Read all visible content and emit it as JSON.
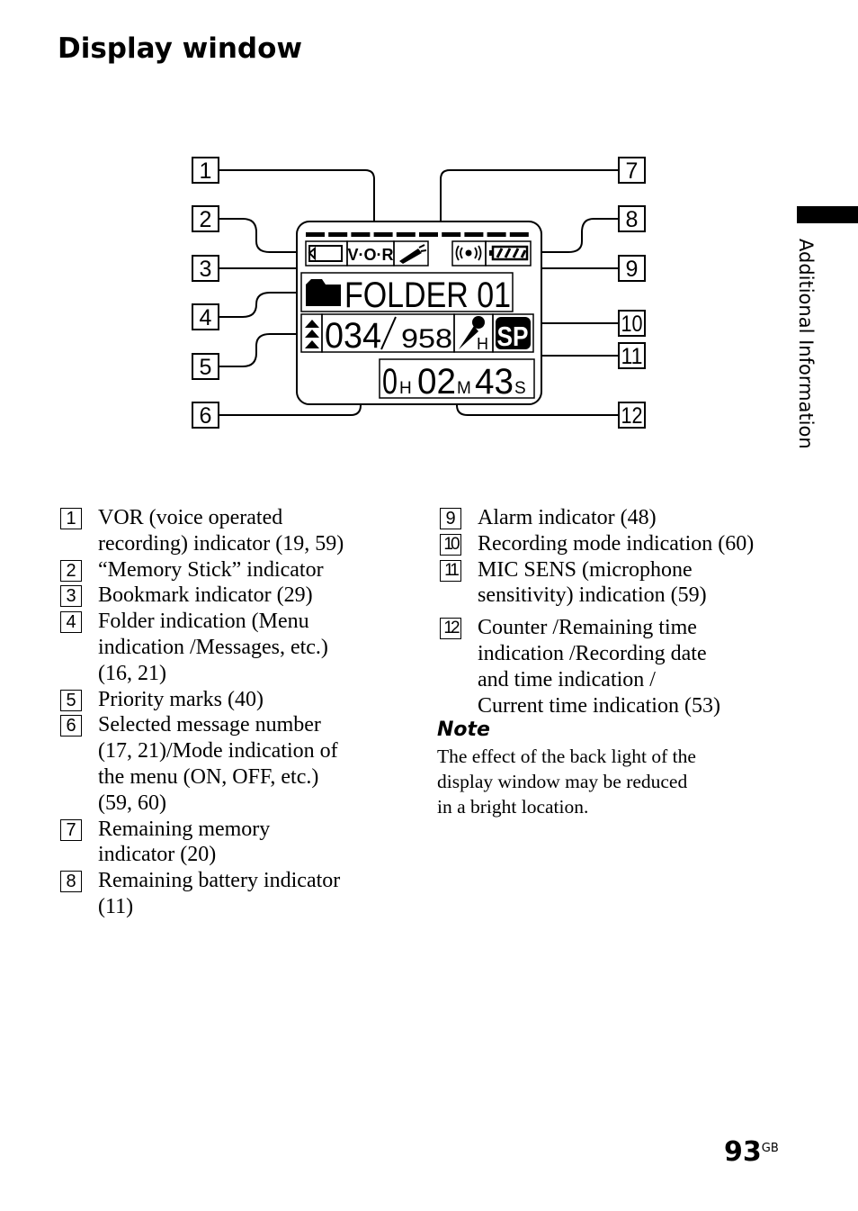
{
  "heading": "Display window",
  "diagram": {
    "callouts_left": [
      "1",
      "2",
      "3",
      "4",
      "5",
      "6"
    ],
    "callouts_right": [
      "7",
      "8",
      "9",
      "10",
      "11",
      "12"
    ],
    "lcd": {
      "memory_stick_icon": "memory-stick-icon",
      "vor": "V·O·R",
      "folder": "FOLDER 01",
      "message": "034",
      "total": "958",
      "mic_level": "H",
      "rec_mode": "SP",
      "counter_h": "0",
      "counter_m": "02",
      "counter_s": "43",
      "unit_h": "H",
      "unit_m": "M",
      "unit_s": "S"
    }
  },
  "left_items": [
    {
      "n": "1",
      "lines": [
        "VOR (voice operated",
        "recording) indicator (19, 59)"
      ]
    },
    {
      "n": "2",
      "lines": [
        "“Memory Stick” indicator"
      ]
    },
    {
      "n": "3",
      "lines": [
        "Bookmark indicator (29)"
      ]
    },
    {
      "n": "4",
      "lines": [
        "Folder indication (Menu",
        "indication /Messages, etc.)",
        "(16, 21)"
      ]
    },
    {
      "n": "5",
      "lines": [
        "Priority marks (40)"
      ]
    },
    {
      "n": "6",
      "lines": [
        "Selected message number",
        "(17, 21)/Mode indication of",
        "the menu (ON, OFF, etc.)",
        "(59, 60)"
      ]
    },
    {
      "n": "7",
      "lines": [
        "Remaining memory",
        "indicator (20)"
      ]
    },
    {
      "n": "8",
      "lines": [
        "Remaining battery indicator",
        "(11)"
      ]
    }
  ],
  "right_items": [
    {
      "n": "9",
      "lines": [
        "Alarm indicator (48)"
      ]
    },
    {
      "n": "10",
      "lines": [
        "Recording mode indication (60)"
      ]
    },
    {
      "n": "11",
      "lines": [
        "MIC SENS (microphone",
        "sensitivity) indication (59)"
      ]
    },
    {
      "n": "12",
      "lines": [
        "Counter /Remaining time",
        "indication /Recording date",
        "and time indication /",
        "Current time indication (53)"
      ]
    }
  ],
  "note": {
    "heading": "Note",
    "lines": [
      "The effect of the back light of the",
      "display window may be reduced",
      "in a bright location."
    ]
  },
  "side_tab": "Additional Information",
  "page": {
    "number": "93",
    "suffix": "GB"
  }
}
